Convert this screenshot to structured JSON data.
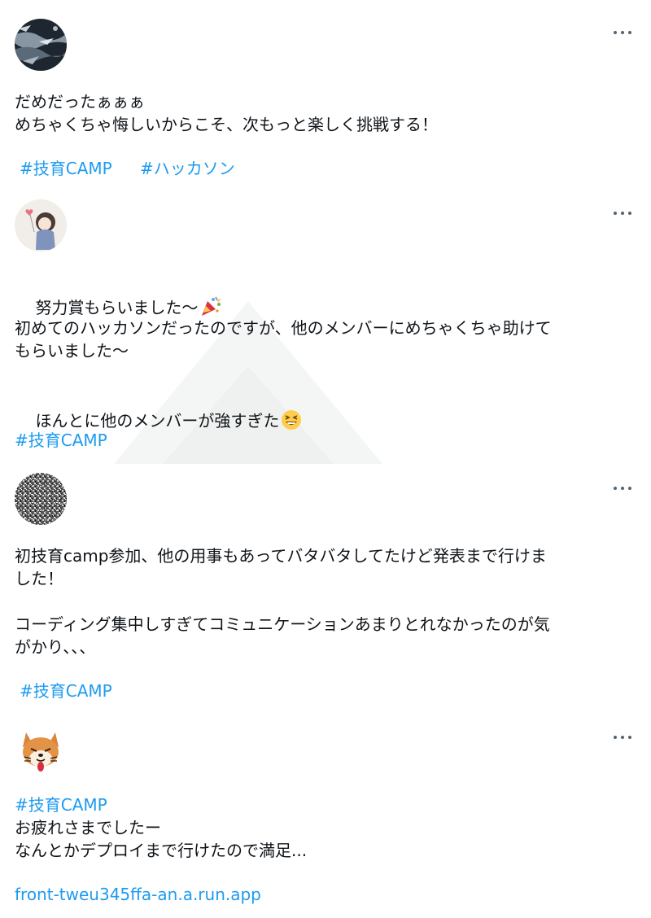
{
  "posts": [
    {
      "avatar": "river-photo-avatar",
      "lines": [
        "だめだったぁぁぁ",
        "めちゃくちゃ悔しいからこそ、次もっと楽しく挑戦する！"
      ],
      "hashtags": [
        "#技育CAMP",
        "#ハッカソン"
      ]
    },
    {
      "avatar": "girl-illustration-avatar",
      "line1": "努力賞もらいました～",
      "line1_emoji": "party-popper-icon",
      "line2": "初めてのハッカソンだったのですが、他のメンバーにめちゃくちゃ助けて",
      "line3": "もらいました～",
      "line4": "ほんとに他のメンバーが強すぎた",
      "line4_emoji": "grinning-squinting-face-icon",
      "hashtags": [
        "#技育CAMP"
      ]
    },
    {
      "avatar": "noise-pattern-avatar",
      "lines": [
        "初技育camp参加、他の用事もあってバタバタしてたけど発表まで行けま",
        "した！",
        "",
        "コーディング集中しすぎてコミュニケーションあまりとれなかったのが気",
        "がかり、、、"
      ],
      "hashtags": [
        "#技育CAMP"
      ]
    },
    {
      "avatar": "shiba-dog-avatar",
      "hashtag": "#技育CAMP",
      "lines": [
        "お疲れさまでしたー",
        "なんとかデプロイまで行けたので満足..."
      ],
      "link": "front-tweu345ffa-an.a.run.app"
    }
  ],
  "colors": {
    "link": "#1d9bf0",
    "text": "#0f1419",
    "icon": "#536471"
  }
}
